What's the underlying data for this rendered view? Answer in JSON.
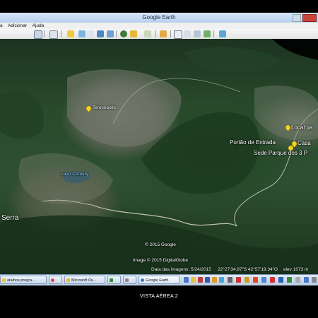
{
  "window": {
    "title": "Google Earth"
  },
  "menu": {
    "items": [
      "a",
      "Adicionar",
      "Ajuda"
    ]
  },
  "map": {
    "places": {
      "teresopolis": "Teresópolis",
      "local": "Local pa",
      "portao": "Portão de Entrada",
      "casa": "Casa",
      "sede": "Sede Parque dos 3 P",
      "serra": "Serra",
      "lake": "Lago Comary"
    },
    "copyright_1": "© 2015 Google",
    "copyright_2": "Image © 2015 DigitalGlobe"
  },
  "status": {
    "imagery_date": "Data das imagens: 5/24/2015",
    "coords": "22°27'34.87\"S  42°57'19.34\"O",
    "elevation": "elev  1073 m"
  },
  "taskbar": {
    "tasks": [
      "atalhos progra...",
      "",
      "Microsoft Ou...",
      "",
      "Google Earth"
    ]
  },
  "caption": "VISTA AÉREA 2",
  "colors": {
    "pin": "#f2d21f",
    "road": "#d9d6cf",
    "forest": "#2a4a2c",
    "urban": "#6e7268"
  }
}
